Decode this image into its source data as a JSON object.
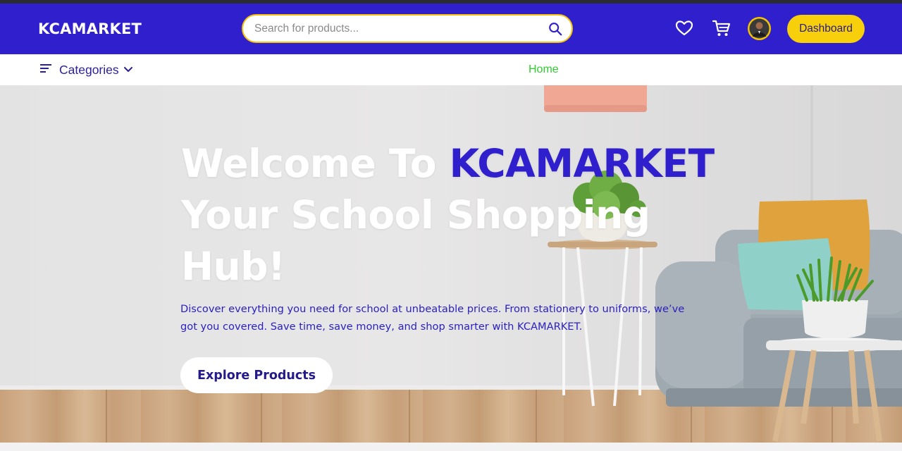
{
  "header": {
    "logo": "KCAMARKET",
    "search_placeholder": "Search for products...",
    "dashboard_label": "Dashboard",
    "icons": [
      "search-icon",
      "heart-icon",
      "cart-icon",
      "avatar"
    ]
  },
  "subnav": {
    "categories_label": "Categories",
    "home_label": "Home"
  },
  "hero": {
    "title_prefix": "Welcome To ",
    "title_brand": "KCAMARKET",
    "title_rest": "Your School Shopping Hub!",
    "subtitle": "Discover everything you need for school at unbeatable prices. From stationery to uniforms, we’ve got you covered. Save time, save money, and shop smarter with KCAMARKET.",
    "cta_label": "Explore Products"
  },
  "colors": {
    "primary": "#2f1fcc",
    "accent": "#f7cf0a",
    "home_link": "#2ecc2e"
  }
}
